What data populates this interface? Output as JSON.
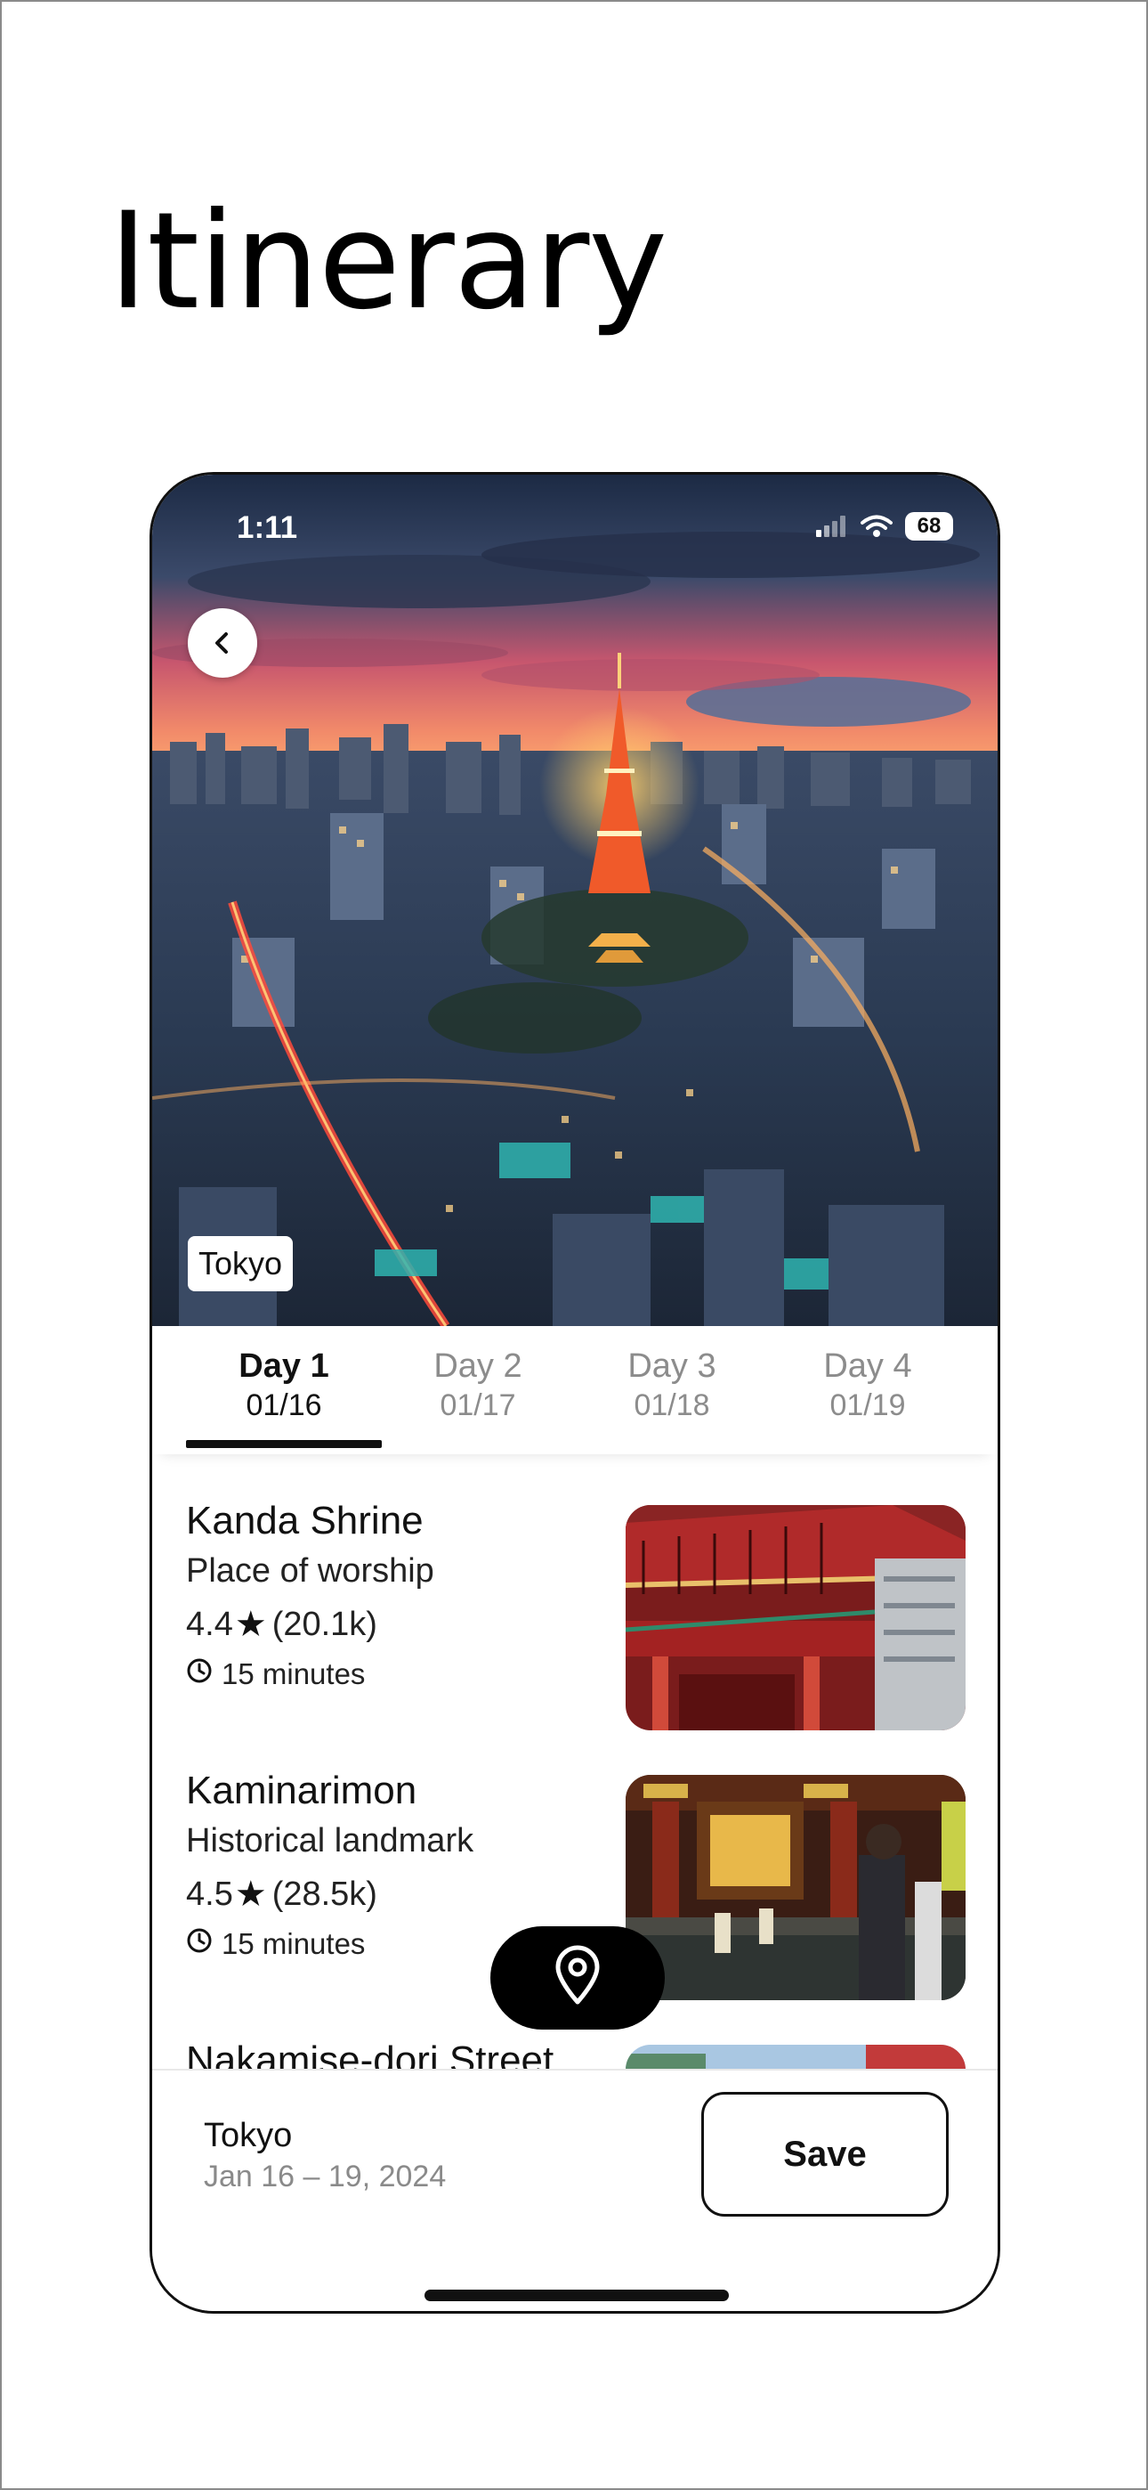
{
  "page": {
    "title": "Itinerary"
  },
  "status_bar": {
    "time": "1:11",
    "battery": "68"
  },
  "hero": {
    "city_tag": "Tokyo"
  },
  "tabs": [
    {
      "label": "Day 1",
      "date": "01/16",
      "active": true
    },
    {
      "label": "Day 2",
      "date": "01/17",
      "active": false
    },
    {
      "label": "Day 3",
      "date": "01/18",
      "active": false
    },
    {
      "label": "Day 4",
      "date": "01/19",
      "active": false
    }
  ],
  "places": [
    {
      "name": "Kanda Shrine",
      "category": "Place of worship",
      "rating": "4.4",
      "reviews": "(20.1k)",
      "duration": "15 minutes"
    },
    {
      "name": "Kaminarimon",
      "category": "Historical landmark",
      "rating": "4.5",
      "reviews": "(28.5k)",
      "duration": "15 minutes"
    },
    {
      "name": "Nakamise-dori Street"
    }
  ],
  "bottom_bar": {
    "city": "Tokyo",
    "dates": "Jan 16 – 19, 2024",
    "save_label": "Save"
  },
  "icons": {
    "back": "chevron-left-icon",
    "map_pin": "map-pin-icon",
    "clock": "clock-icon",
    "star": "star-icon",
    "signal": "cellular-signal-icon",
    "wifi": "wifi-icon",
    "battery": "battery-icon"
  },
  "colors": {
    "accent": "#000000",
    "muted_text": "#8a8a8a",
    "background": "#ffffff"
  }
}
